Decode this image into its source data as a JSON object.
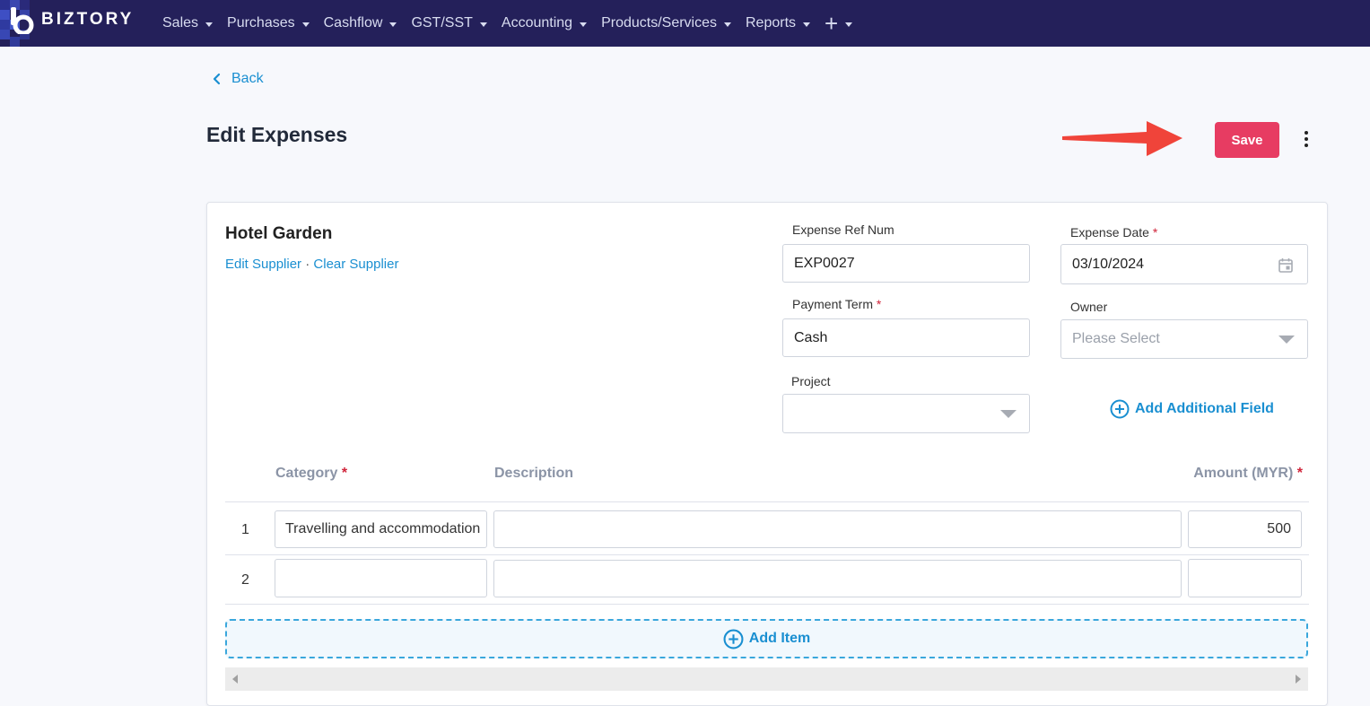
{
  "brand": {
    "name": "BIZTORY"
  },
  "nav": {
    "items": [
      {
        "label": "Sales"
      },
      {
        "label": "Purchases"
      },
      {
        "label": "Cashflow"
      },
      {
        "label": "GST/SST"
      },
      {
        "label": "Accounting"
      },
      {
        "label": "Products/Services"
      },
      {
        "label": "Reports"
      }
    ],
    "more_icon": "plus-icon"
  },
  "header": {
    "back_label": "Back",
    "title": "Edit Expenses",
    "save_label": "Save",
    "annotation_color": "#f0443a"
  },
  "supplier": {
    "name": "Hotel Garden",
    "edit_label": "Edit Supplier",
    "separator": "·",
    "clear_label": "Clear Supplier"
  },
  "form": {
    "ref_num": {
      "label": "Expense Ref Num",
      "value": "EXP0027"
    },
    "date": {
      "label": "Expense Date",
      "required": "*",
      "value": "03/10/2024"
    },
    "payment_term": {
      "label": "Payment Term",
      "required": "*",
      "value": "Cash"
    },
    "owner": {
      "label": "Owner",
      "placeholder": "Please Select"
    },
    "project": {
      "label": "Project",
      "value": ""
    },
    "add_field_label": "Add Additional Field"
  },
  "table": {
    "headers": {
      "category": "Category",
      "category_required": "*",
      "description": "Description",
      "amount": "Amount (MYR)",
      "amount_required": "*"
    },
    "rows": [
      {
        "num": "1",
        "category": "Travelling and accommodation",
        "description": "",
        "amount": "500"
      },
      {
        "num": "2",
        "category": "",
        "description": "",
        "amount": ""
      }
    ],
    "add_item_label": "Add Item"
  },
  "colors": {
    "nav_bg": "#24205a",
    "accent": "#1a8fd1",
    "save": "#e73c62"
  }
}
